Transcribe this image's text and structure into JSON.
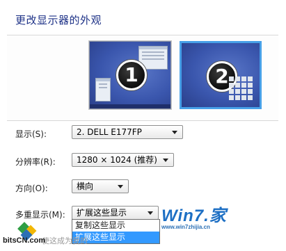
{
  "header": {
    "title": "更改显示器的外观"
  },
  "monitors": [
    {
      "number": "1",
      "selected": false
    },
    {
      "number": "2",
      "selected": true
    }
  ],
  "settings": {
    "display_label": "显示(S):",
    "display_value": "2. DELL E177FP",
    "resolution_label": "分辨率(R):",
    "resolution_value": "1280 × 1024 (推荐)",
    "orientation_label": "方向(O):",
    "orientation_value": "横向",
    "multi_display_label": "多重显示(M):",
    "multi_display_value": "扩展这些显示",
    "multi_display_options": [
      "复制这些显示",
      "扩展这些显示"
    ],
    "partial_text": "使这成为我的"
  },
  "watermark": {
    "brand": "Win7.家",
    "url": "www.win7zhijia.cn"
  },
  "site_logo": {
    "text": "bitsCN.com"
  },
  "colors": {
    "accent": "#3399ff",
    "title": "#1e3287",
    "selected_border": "#47a0e8"
  }
}
